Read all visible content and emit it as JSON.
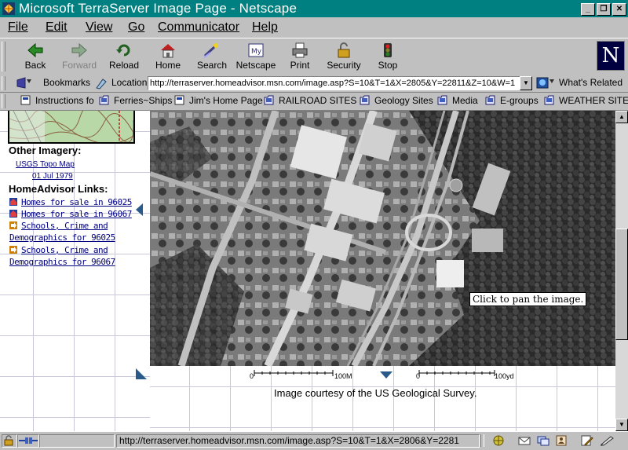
{
  "window": {
    "title": "Microsoft TerraServer Image Page - Netscape"
  },
  "menu": [
    "File",
    "Edit",
    "View",
    "Go",
    "Communicator",
    "Help"
  ],
  "toolbar": {
    "back": "Back",
    "forward": "Forward",
    "reload": "Reload",
    "home": "Home",
    "search": "Search",
    "netscape": "Netscape",
    "print": "Print",
    "security": "Security",
    "stop": "Stop",
    "logo": "N"
  },
  "location": {
    "bookmarks": "Bookmarks",
    "label": "Location:",
    "url": "http://terraserver.homeadvisor.msn.com/image.asp?S=10&T=1&X=2805&Y=22811&Z=10&W=1",
    "whats_related": "What's Related"
  },
  "personal": [
    "Instructions fo",
    "Ferries~Ships",
    "Jim's Home Page",
    "RAILROAD SITES",
    "Geology Sites",
    "Media",
    "E-groups",
    "WEATHER SITES"
  ],
  "sidebar": {
    "other_imagery": "Other Imagery:",
    "topo_link": "USGS Topo Map",
    "topo_date": "01 Jul 1979",
    "homeadvisor": "HomeAdvisor Links:",
    "links": [
      "Homes for sale in 96025",
      "Homes for sale in 96067",
      "Schools, Crime and",
      "Demographics for 96025",
      "Schools, Crime and",
      "Demographics for 96067"
    ]
  },
  "map": {
    "tooltip": "Click to pan the image.",
    "scale_m_start": "0",
    "scale_m_end": "100M",
    "scale_yd_start": "0",
    "scale_yd_end": "100yd",
    "courtesy": "Image courtesy of the US Geological Survey."
  },
  "status": {
    "url": "http://terraserver.homeadvisor.msn.com/image.asp?S=10&T=1&X=2806&Y=2281"
  }
}
